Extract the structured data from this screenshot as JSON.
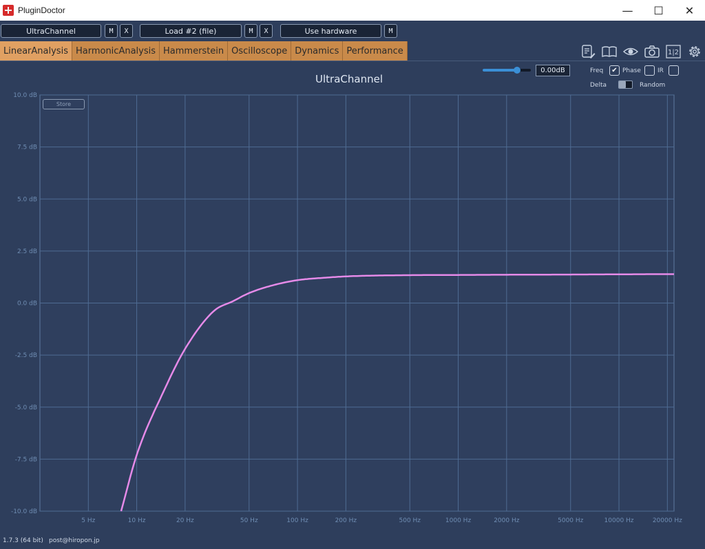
{
  "window": {
    "title": "PluginDoctor",
    "minimize_glyph": "—",
    "maximize_glyph": "☐",
    "close_glyph": "✕"
  },
  "slots": [
    {
      "label": "UltraChannel"
    },
    {
      "label": "Load #2 (file)"
    },
    {
      "label": "Use hardware"
    }
  ],
  "slot_buttons": {
    "m": "M",
    "x": "X"
  },
  "tabs": [
    {
      "label": "LinearAnalysis",
      "active": true
    },
    {
      "label": "HarmonicAnalysis"
    },
    {
      "label": "Hammerstein"
    },
    {
      "label": "Oscilloscope"
    },
    {
      "label": "Dynamics"
    },
    {
      "label": "Performance"
    }
  ],
  "toolbar": {
    "icons": [
      "notes-icon",
      "book-icon",
      "eye-icon",
      "camera-icon",
      "compare-icon",
      "gear-icon"
    ],
    "compare_label": "1|2"
  },
  "controls": {
    "gain_value": "0.00dB",
    "gain_slider_fraction": 0.71,
    "freq_label": "Freq",
    "freq_checked": true,
    "phase_label": "Phase",
    "phase_checked": false,
    "ir_label": "IR",
    "ir_checked": false,
    "delta_label": "Delta",
    "random_label": "Random",
    "delta_random_toggle": "delta"
  },
  "store_label": "Store",
  "chart_data": {
    "type": "line",
    "title": "UltraChannel",
    "xscale": "log",
    "xlim": [
      2.5,
      22000
    ],
    "ylim": [
      -10,
      10
    ],
    "grid": true,
    "line_color": "#e58ae8",
    "y_ticks": [
      "10.0 dB",
      "7.5 dB",
      "5.0 dB",
      "2.5 dB",
      "0.0 dB",
      "-2.5 dB",
      "-5.0 dB",
      "-7.5 dB",
      "-10.0 dB"
    ],
    "y_tick_values": [
      10,
      7.5,
      5,
      2.5,
      0,
      -2.5,
      -5,
      -7.5,
      -10
    ],
    "x_ticks": [
      "5 Hz",
      "10 Hz",
      "20 Hz",
      "50 Hz",
      "100 Hz",
      "200 Hz",
      "500 Hz",
      "1000 Hz",
      "2000 Hz",
      "5000 Hz",
      "10000 Hz",
      "20000 Hz"
    ],
    "x_tick_values": [
      5,
      10,
      20,
      50,
      100,
      200,
      500,
      1000,
      2000,
      5000,
      10000,
      20000
    ],
    "series": [
      {
        "x": [
          8,
          10,
          15,
          20,
          30,
          40,
          50,
          70,
          100,
          150,
          200,
          300,
          500,
          1000,
          2000,
          5000,
          10000,
          20000,
          22000
        ],
        "y": [
          -10.0,
          -7.3,
          -4.1,
          -2.2,
          -0.4,
          0.1,
          0.48,
          0.85,
          1.1,
          1.22,
          1.28,
          1.32,
          1.34,
          1.35,
          1.36,
          1.37,
          1.38,
          1.39,
          1.39
        ]
      }
    ]
  },
  "footer": {
    "version": "1.7.3 (64 bit)",
    "email": "post@hiropon.jp"
  }
}
